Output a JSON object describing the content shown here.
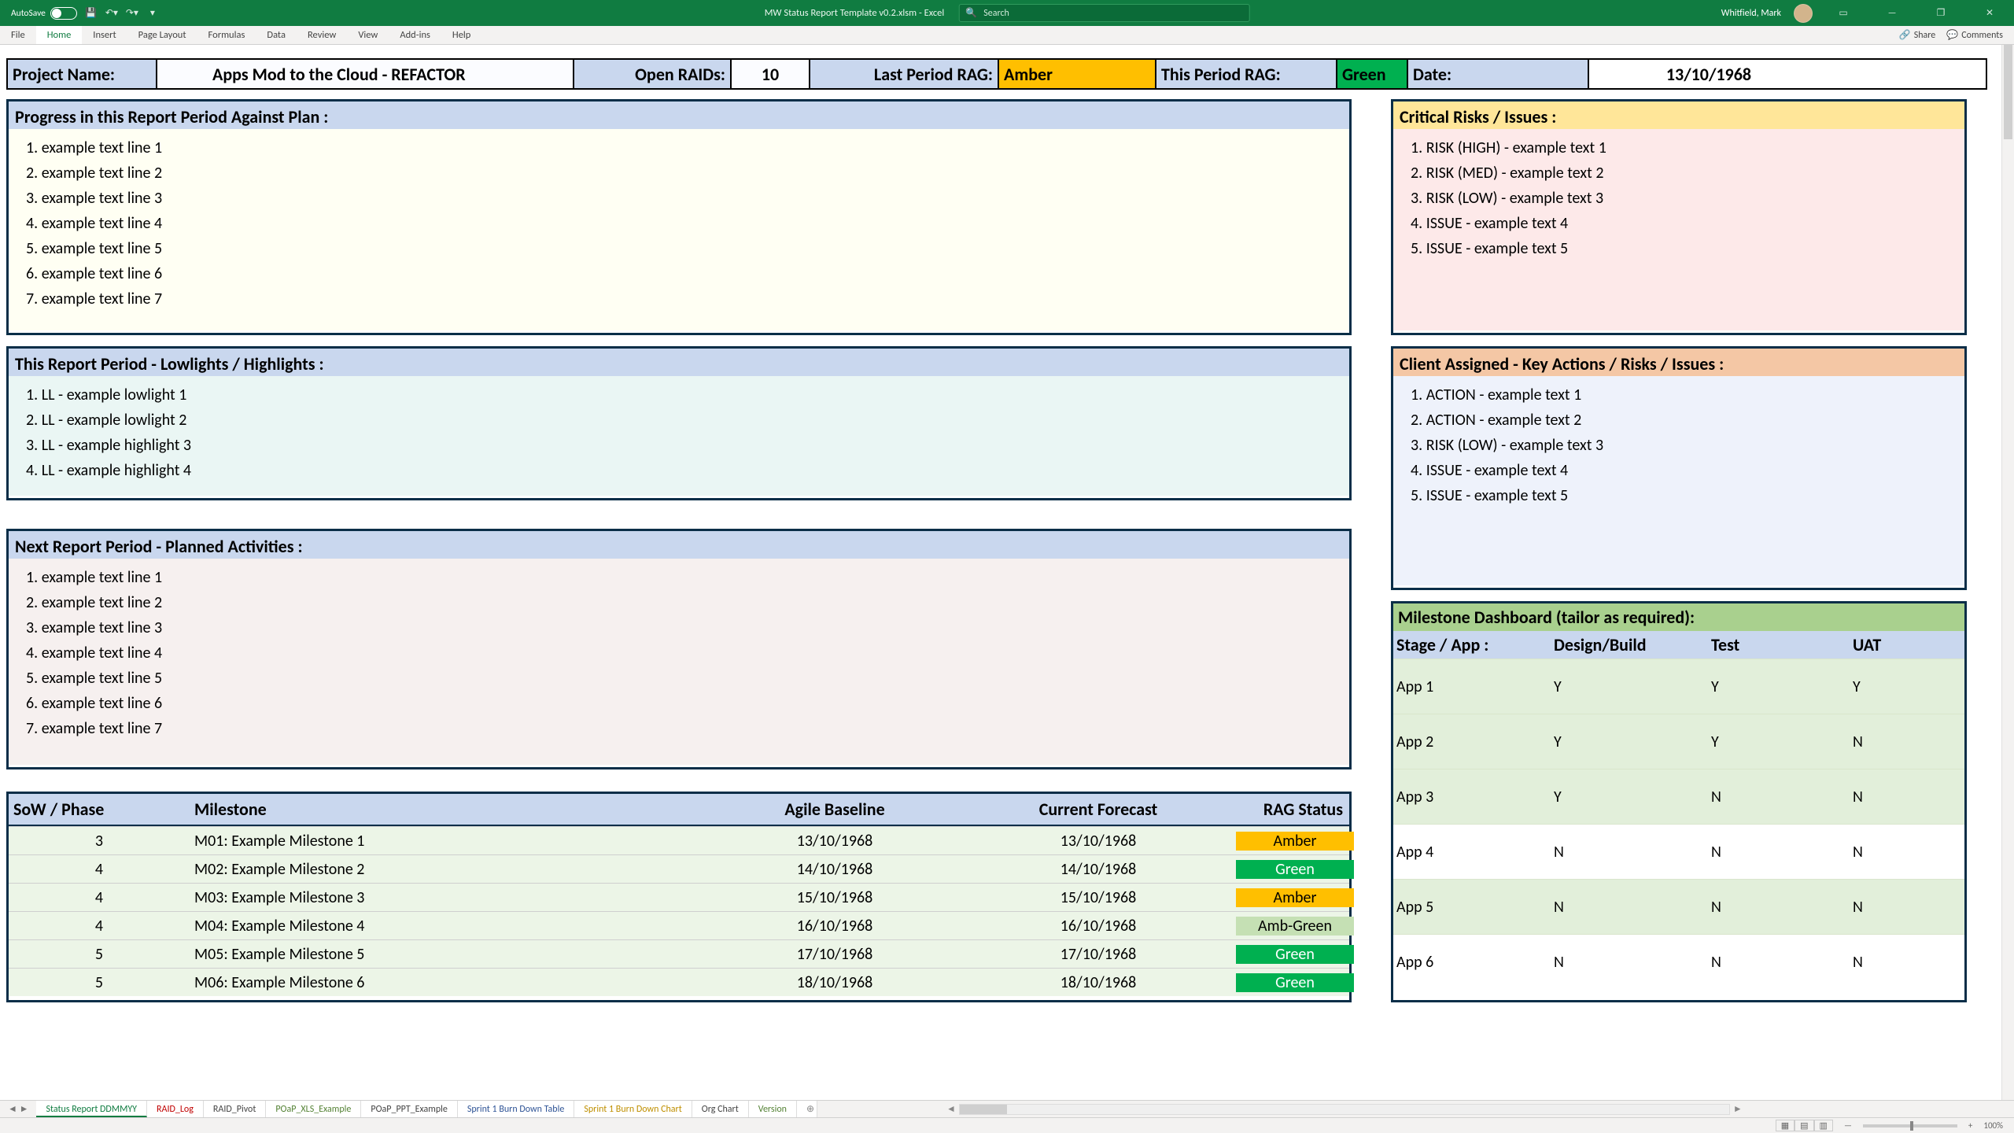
{
  "titlebar": {
    "autosave_label": "AutoSave",
    "doc_title": "MW Status Report Template v0.2.xlsm - Excel",
    "search_placeholder": "Search",
    "user_name": "Whitfield, Mark"
  },
  "ribbon": {
    "tabs": [
      "File",
      "Home",
      "Insert",
      "Page Layout",
      "Formulas",
      "Data",
      "Review",
      "View",
      "Add-ins",
      "Help"
    ],
    "share": "Share",
    "comments": "Comments"
  },
  "header": {
    "project_label": "Project Name:",
    "project_value": "Apps Mod to the Cloud - REFACTOR",
    "raids_label": "Open RAIDs:",
    "raids_value": "10",
    "last_rag_label": "Last Period RAG:",
    "last_rag_value": "Amber",
    "this_rag_label": "This Period RAG:",
    "this_rag_value": "Green",
    "date_label": "Date:",
    "date_value": "13/10/1968"
  },
  "progress": {
    "title": "Progress in this Report Period Against Plan :",
    "lines": [
      "example text line 1",
      "example text line 2",
      "example text line 3",
      "example text line 4",
      "example text line 5",
      "example text line 6",
      "example text line 7"
    ]
  },
  "lowhigh": {
    "title": "This Report Period - Lowlights / Highlights :",
    "lines": [
      "LL - example lowlight 1",
      "LL - example lowlight 2",
      "LL - example highlight 3",
      "LL - example highlight 4"
    ]
  },
  "planned": {
    "title": "Next Report Period - Planned Activities :",
    "lines": [
      "example text line 1",
      "example text line 2",
      "example text line 3",
      "example text line 4",
      "example text line 5",
      "example text line 6",
      "example text line 7"
    ]
  },
  "milestones": {
    "headers": {
      "c1": "SoW / Phase",
      "c2": "Milestone",
      "c3": "Agile Baseline",
      "c4": "Current Forecast",
      "c5": "RAG Status"
    },
    "rows": [
      {
        "c1": "3",
        "c2": "M01: Example Milestone 1",
        "c3": "13/10/1968",
        "c4": "13/10/1968",
        "c5": "Amber"
      },
      {
        "c1": "4",
        "c2": "M02: Example Milestone 2",
        "c3": "14/10/1968",
        "c4": "14/10/1968",
        "c5": "Green"
      },
      {
        "c1": "4",
        "c2": "M03: Example Milestone 3",
        "c3": "15/10/1968",
        "c4": "15/10/1968",
        "c5": "Amber"
      },
      {
        "c1": "4",
        "c2": "M04: Example Milestone 4",
        "c3": "16/10/1968",
        "c4": "16/10/1968",
        "c5": "Amb-Green"
      },
      {
        "c1": "5",
        "c2": "M05: Example Milestone 5",
        "c3": "17/10/1968",
        "c4": "17/10/1968",
        "c5": "Green"
      },
      {
        "c1": "5",
        "c2": "M06: Example Milestone 6",
        "c3": "18/10/1968",
        "c4": "18/10/1968",
        "c5": "Green"
      }
    ]
  },
  "risks": {
    "title": "Critical Risks / Issues :",
    "lines": [
      "RISK (HIGH) - example text 1",
      "RISK (MED) - example text 2",
      "RISK (LOW) - example text 3",
      "ISSUE - example text 4",
      "ISSUE - example text 5"
    ]
  },
  "client": {
    "title": "Client Assigned - Key Actions / Risks / Issues :",
    "lines": [
      "ACTION - example text 1",
      "ACTION - example text 2",
      "RISK (LOW) - example text 3",
      "ISSUE - example text 4",
      "ISSUE - example text 5"
    ]
  },
  "dash": {
    "title": "Milestone Dashboard (tailor as required):",
    "headers": {
      "c1": "Stage / App :",
      "c2": "Design/Build",
      "c3": "Test",
      "c4": "UAT"
    },
    "rows": [
      {
        "c1": "App 1",
        "c2": "Y",
        "c3": "Y",
        "c4": "Y",
        "g": true
      },
      {
        "c1": "App 2",
        "c2": "Y",
        "c3": "Y",
        "c4": "N",
        "g": true
      },
      {
        "c1": "App 3",
        "c2": "Y",
        "c3": "N",
        "c4": "N",
        "g": true
      },
      {
        "c1": "App 4",
        "c2": "N",
        "c3": "N",
        "c4": "N",
        "g": false
      },
      {
        "c1": "App 5",
        "c2": "N",
        "c3": "N",
        "c4": "N",
        "g": true
      },
      {
        "c1": "App 6",
        "c2": "N",
        "c3": "N",
        "c4": "N",
        "g": false
      }
    ]
  },
  "sheet_tabs": [
    {
      "label": "Status Report DDMMYY",
      "cls": "active"
    },
    {
      "label": "RAID_Log",
      "cls": "tab-red"
    },
    {
      "label": "RAID_Pivot",
      "cls": ""
    },
    {
      "label": "POaP_XLS_Example",
      "cls": "tab-green"
    },
    {
      "label": "POaP_PPT_Example",
      "cls": ""
    },
    {
      "label": "Sprint 1 Burn Down Table",
      "cls": "tab-blue"
    },
    {
      "label": "Sprint 1 Burn Down Chart",
      "cls": "tab-orange"
    },
    {
      "label": "Org Chart",
      "cls": ""
    },
    {
      "label": "Version",
      "cls": "tab-green"
    }
  ],
  "statusbar": {
    "zoom": "100%"
  }
}
